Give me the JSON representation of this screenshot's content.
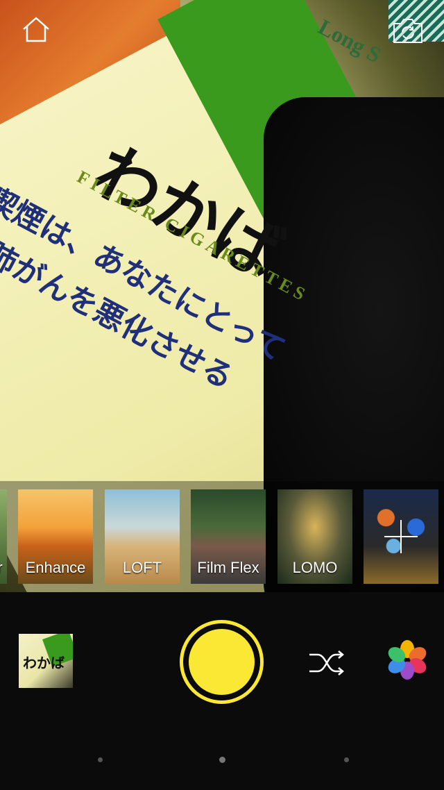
{
  "viewfinder": {
    "text_brand": "わかば",
    "text_subtitle": "FILTER CIGARETTES",
    "text_warning1": "喫煙は、あなたにとって",
    "text_warning2": "肺がんを悪化させる",
    "text_corner": "Long S"
  },
  "top_bar": {
    "home_icon": "home-icon",
    "switch_camera_icon": "switch-camera-icon"
  },
  "filters": [
    {
      "label": "r"
    },
    {
      "label": "Enhance"
    },
    {
      "label": "LOFT"
    },
    {
      "label": "Film Flex"
    },
    {
      "label": "LOMO"
    },
    {
      "label": ""
    }
  ],
  "controls": {
    "last_photo_text": "わかば",
    "shutter_color": "#fbe835",
    "shuffle_icon": "shuffle-icon",
    "gallery_icon": "gallery-icon"
  }
}
